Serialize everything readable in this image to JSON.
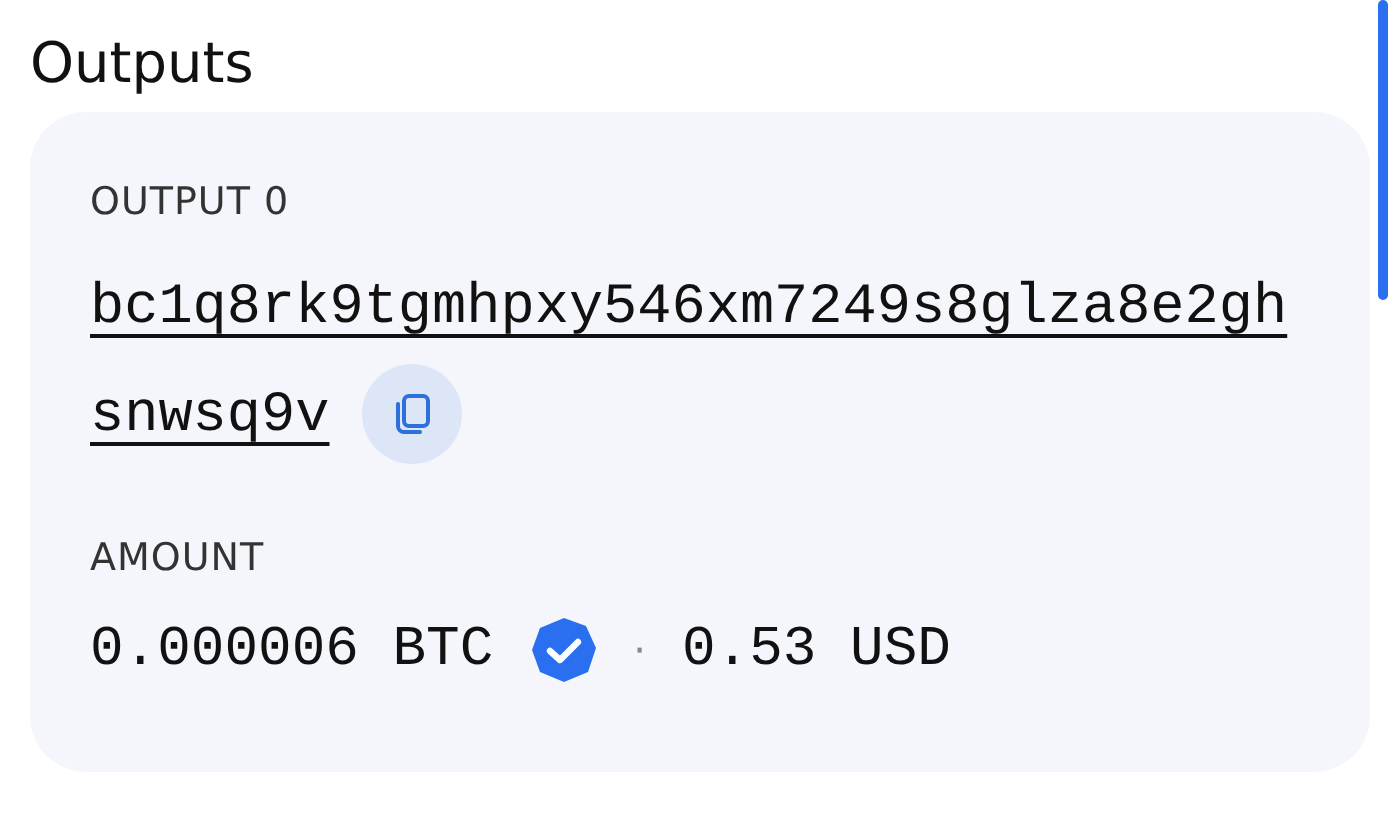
{
  "section_title": "Outputs",
  "output": {
    "label": "OUTPUT 0",
    "address_lines": [
      "bc1q8rk9tgmhpxy546xm7249s8glza8e2gh",
      "snwsq9v"
    ],
    "amount_label": "AMOUNT",
    "amount": "0.000006 BTC",
    "verified": true,
    "separator": "·",
    "fiat": "0.53 USD"
  }
}
